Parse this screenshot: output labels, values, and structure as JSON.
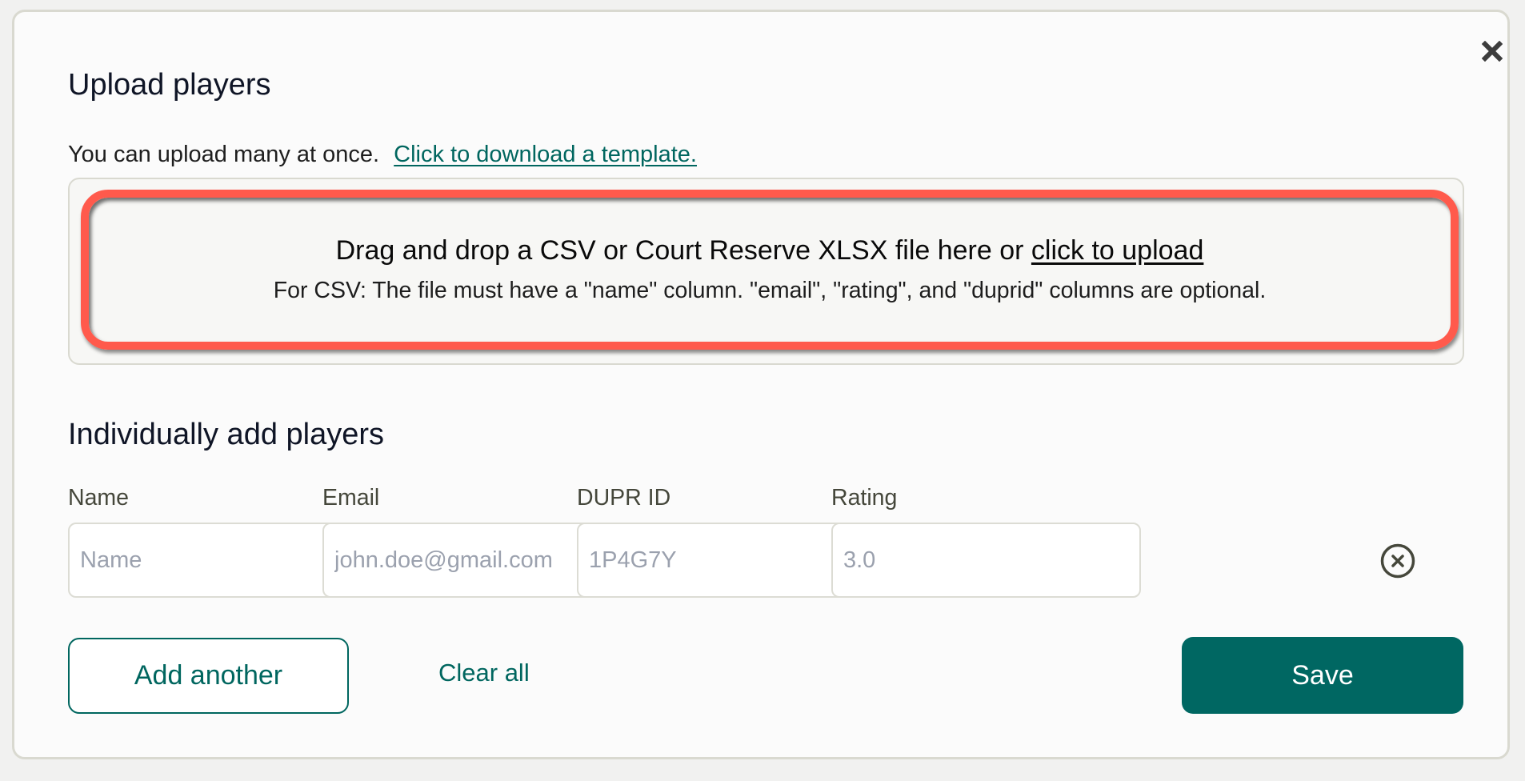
{
  "dialog": {
    "title": "Upload players",
    "subtitle": "You can upload many at once.",
    "template_link": "Click to download a template.",
    "close_icon": "close-icon"
  },
  "dropzone": {
    "main_text": "Drag and drop a CSV or Court Reserve XLSX file here or ",
    "upload_link": "click to upload",
    "hint": "For CSV: The file must have a \"name\" column. \"email\", \"rating\", and \"duprid\" columns are optional.",
    "highlight_color": "#ff5a4c"
  },
  "individual": {
    "heading": "Individually add players",
    "columns": [
      {
        "label": "Name",
        "placeholder": "Name",
        "value": ""
      },
      {
        "label": "Email",
        "placeholder": "john.doe@gmail.com",
        "value": ""
      },
      {
        "label": "DUPR ID",
        "placeholder": "1P4G7Y",
        "value": ""
      },
      {
        "label": "Rating",
        "placeholder": "3.0",
        "value": ""
      }
    ],
    "remove_icon": "circle-x-icon"
  },
  "actions": {
    "add_another": "Add another",
    "clear_all": "Clear all",
    "save": "Save"
  },
  "colors": {
    "accent": "#006762",
    "link": "#00665f",
    "border": "#d9d9d0"
  }
}
